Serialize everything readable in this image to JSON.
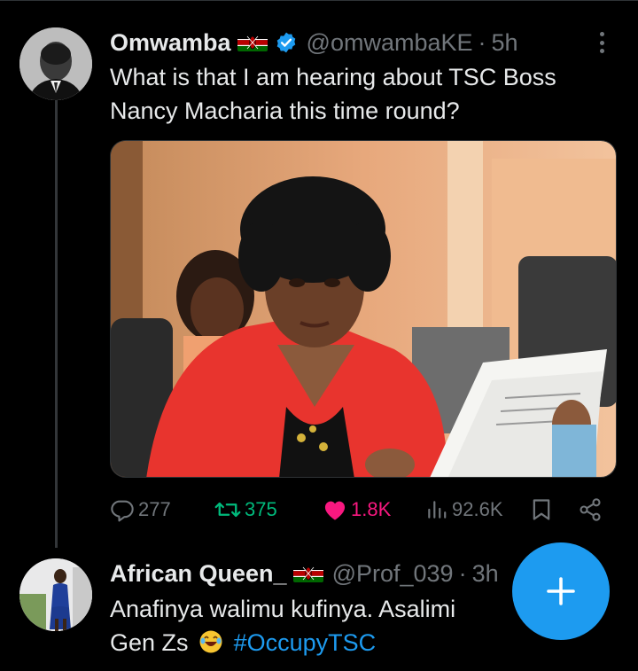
{
  "tweet1": {
    "display_name": "Omwamba",
    "handle": "@omwambaKE",
    "separator": "·",
    "time": "5h",
    "text": "What is that I am hearing about TSC Boss Nancy Macharia this time round?",
    "stats": {
      "replies": "277",
      "retweets": "375",
      "likes": "1.8K",
      "views": "92.6K"
    }
  },
  "tweet2": {
    "display_name": "African Queen_",
    "handle": "@Prof_039",
    "separator": "·",
    "time": "3h",
    "text_main": "Anafinya walimu kufinya. Asalimi",
    "text_line2_start": "Gen Zs",
    "hashtag": "#OccupyTSC"
  },
  "icons": {
    "reply": "reply-icon",
    "retweet": "retweet-icon",
    "like": "heart-icon",
    "views": "views-icon",
    "bookmark": "bookmark-icon",
    "share": "share-icon",
    "compose": "plus-icon",
    "more": "more-icon",
    "verified": "verified-badge-icon",
    "flag": "kenya-flag-icon",
    "emoji": "laughing-emoji-icon"
  },
  "colors": {
    "background": "#000000",
    "text": "#e7e9ea",
    "secondary": "#71767b",
    "accent": "#1d9bf0",
    "retweet": "#00ba7c",
    "like": "#f91880"
  }
}
